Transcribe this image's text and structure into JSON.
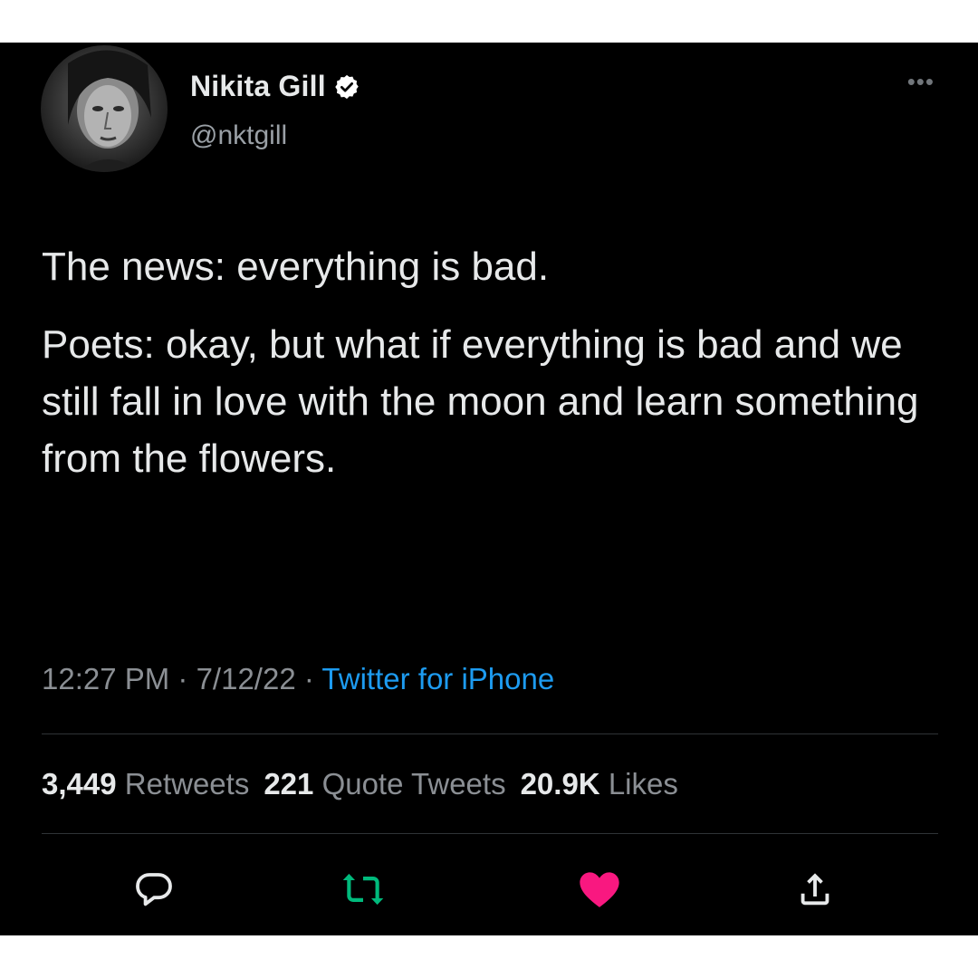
{
  "author": {
    "display_name": "Nikita Gill",
    "handle": "@nktgill",
    "verified": true
  },
  "tweet": {
    "paragraphs": [
      "The news: everything is bad.",
      "Poets: okay, but what if everything is bad and we still fall in love with the moon and learn something from the flowers."
    ],
    "time": "12:27 PM",
    "separator": " · ",
    "date": "7/12/22",
    "source": "Twitter for iPhone"
  },
  "stats": {
    "retweets_count": "3,449",
    "retweets_label": "Retweets",
    "quotes_count": "221",
    "quotes_label": "Quote Tweets",
    "likes_count": "20.9K",
    "likes_label": "Likes"
  },
  "actions": {
    "reply_icon": "reply-icon",
    "retweet_icon": "retweet-icon",
    "like_icon": "heart-icon",
    "share_icon": "share-icon"
  },
  "colors": {
    "background": "#000000",
    "text": "#e7e9ea",
    "muted": "#8b8f94",
    "link": "#1d9bf0",
    "retweeted": "#00ba7c",
    "liked": "#f91880",
    "verified": "#ffffff"
  }
}
